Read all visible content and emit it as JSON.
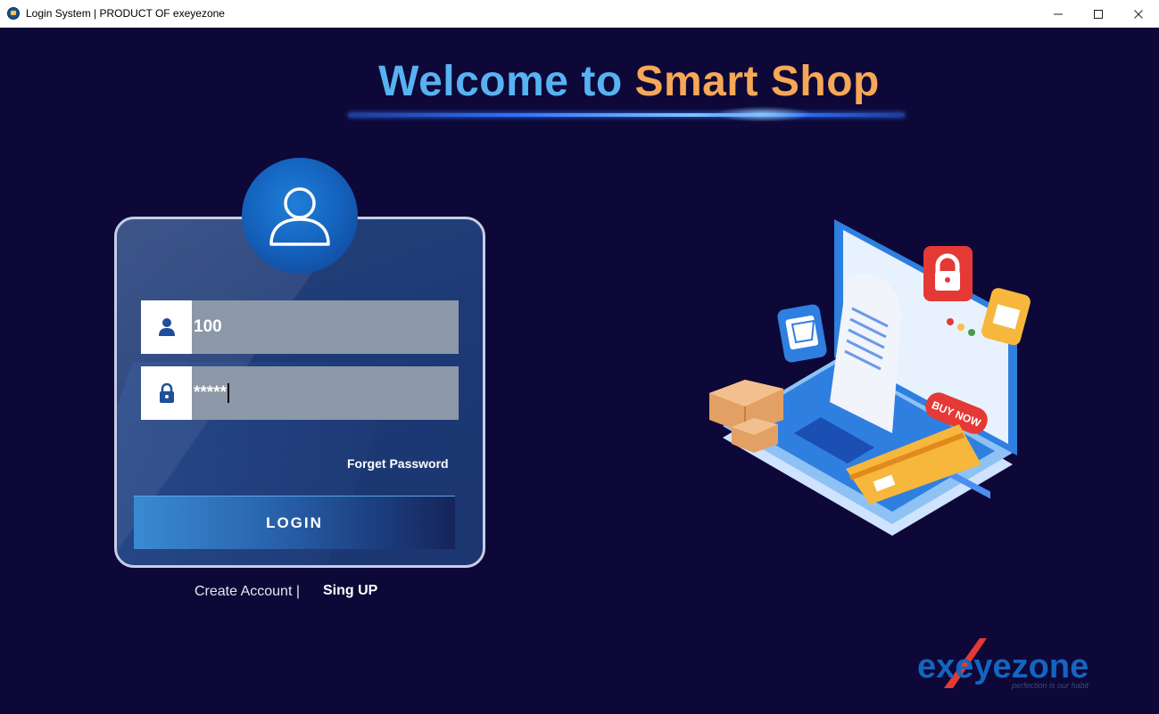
{
  "window": {
    "title": "Login System | PRODUCT OF exeyezone",
    "controls": {
      "minimize_icon": "minimize-icon",
      "maximize_icon": "maximize-icon",
      "close_icon": "close-icon"
    }
  },
  "header": {
    "welcome": "Welcome to",
    "app_name": "Smart Shop"
  },
  "login_form": {
    "avatar_icon": "user-icon",
    "username": {
      "icon": "user-icon",
      "value": "100"
    },
    "password": {
      "icon": "lock-icon",
      "value": "*****"
    },
    "forget_password": "Forget Password",
    "login_button": "LOGIN"
  },
  "footer_links": {
    "create_account": "Create Account  |",
    "sign_up": "Sing UP"
  },
  "illustration": {
    "badge_text": "BUY NOW"
  },
  "brand": {
    "name": "exeyezone",
    "tagline": "perfection is our habit"
  },
  "colors": {
    "background": "#0d0837",
    "heading_blue": "#58b2f2",
    "heading_orange": "#f6a757",
    "card": "#1d3a76",
    "input": "#8c98a8",
    "brand_blue": "#1565c0",
    "brand_red": "#e53935"
  }
}
